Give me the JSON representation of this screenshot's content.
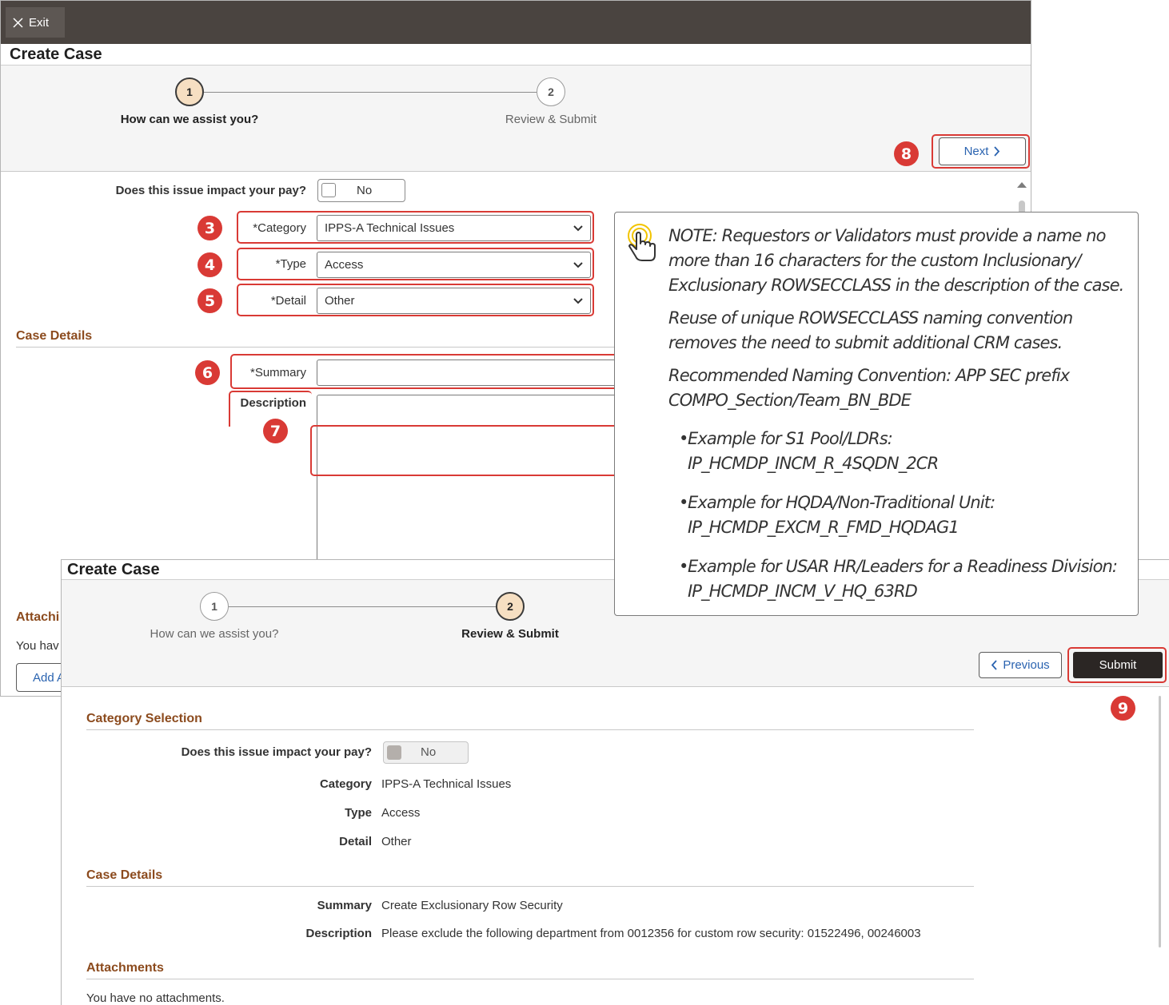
{
  "screen1": {
    "exit_label": "Exit",
    "title": "Create Case",
    "steps": [
      {
        "number": "1",
        "label": "How can we assist you?"
      },
      {
        "number": "2",
        "label": "Review & Submit"
      }
    ],
    "next_label": "Next",
    "pay_question": "Does this issue impact your pay?",
    "pay_value": "No",
    "category_label": "*Category",
    "category_value": "IPPS-A Technical Issues",
    "type_label": "*Type",
    "type_value": "Access",
    "detail_label": "*Detail",
    "detail_value": "Other",
    "case_details_title": "Case Details",
    "summary_label": "*Summary",
    "description_label": "Description",
    "attachments_partial": "Attachi",
    "no_attachments_partial": "You hav",
    "add_attachment_partial": "Add A"
  },
  "screen2": {
    "title": "Create Case",
    "steps": [
      {
        "number": "1",
        "label": "How can we assist you?"
      },
      {
        "number": "2",
        "label": "Review & Submit"
      }
    ],
    "previous_label": "Previous",
    "submit_label": "Submit",
    "category_selection_title": "Category Selection",
    "pay_question": "Does this issue impact your pay?",
    "pay_value": "No",
    "category_label": "Category",
    "category_value": "IPPS-A Technical Issues",
    "type_label": "Type",
    "type_value": "Access",
    "detail_label": "Detail",
    "detail_value": "Other",
    "case_details_title": "Case Details",
    "summary_label": "Summary",
    "summary_value": "Create Exclusionary Row Security",
    "description_label": "Description",
    "description_value": "Please exclude the following department from 0012356 for custom row security: 01522496, 00246003",
    "attachments_title": "Attachments",
    "no_attachments": "You have no attachments."
  },
  "badges": [
    "3",
    "4",
    "5",
    "6",
    "7",
    "8",
    "9"
  ],
  "note": {
    "lines": [
      "NOTE: Requestors or Validators must provide a name no",
      "more than 16 characters for the custom Inclusionary/",
      "Exclusionary ROWSECCLASS in the description of the case.",
      "Reuse of unique ROWSECCLASS naming convention",
      "removes the need to submit additional CRM cases.",
      "Recommended Naming Convention: APP SEC prefix",
      "COMPO_Section/Team_BN_BDE"
    ],
    "examples": [
      {
        "title": "Example for S1 Pool/LDRs:",
        "value": "IP_HCMDP_INCM_R_4SQDN_2CR"
      },
      {
        "title": "Example for HQDA/Non-Traditional Unit:",
        "value": "IP_HCMDP_EXCM_R_FMD_HQDAG1"
      },
      {
        "title": "Example for USAR HR/Leaders for a Readiness Division:",
        "value": "IP_HCMDP_INCM_V_HQ_63RD"
      }
    ],
    "bullet_char": "•",
    "icon": "pointing-hand-icon"
  },
  "colors": {
    "annotation_red": "#d93a35",
    "section_brown": "#8c4b1e",
    "topbar": "#4a4440",
    "link_blue": "#2a63b0",
    "step_active_fill": "#f6dfc2",
    "icon_yellow": "#f2c400"
  }
}
